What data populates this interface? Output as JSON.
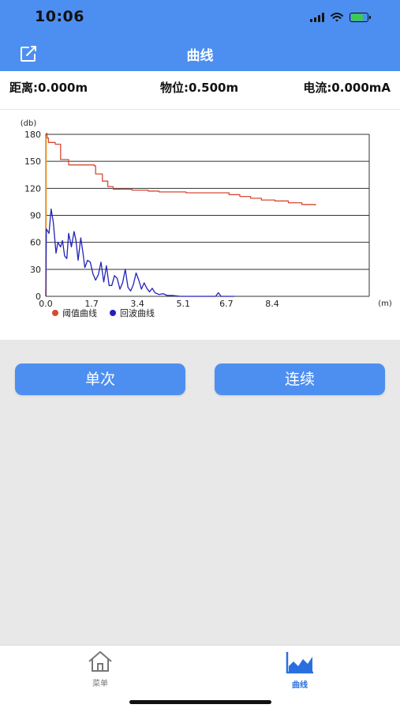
{
  "status_bar": {
    "time": "10:06",
    "battery_level": 0.8,
    "battery_color": "#3ccc4a"
  },
  "header": {
    "title": "曲线",
    "icon": "edit-icon",
    "background": "#4d8ff0"
  },
  "info": {
    "distance": "距离:0.000m",
    "level": "物位:0.500m",
    "current": "电流:0.000mA"
  },
  "chart_data": {
    "type": "line",
    "ylabel": "(db)",
    "xlabel": "(m)",
    "ylim": [
      0,
      180
    ],
    "xlim": [
      0,
      12
    ],
    "y_ticks": [
      "0",
      "30",
      "60",
      "90",
      "120",
      "150",
      "180"
    ],
    "x_ticks": [
      "0.0",
      "1.7",
      "3.4",
      "5.1",
      "6.7",
      "8.4"
    ],
    "x_tick_values": [
      0,
      1.7,
      3.4,
      5.1,
      6.7,
      8.4
    ],
    "grid": true,
    "legend_position": "bottom-left",
    "series": [
      {
        "name": "阈值曲线",
        "color": "#d84a36",
        "x": [
          0,
          0.05,
          0.1,
          0.3,
          0.35,
          0.5,
          0.55,
          0.8,
          0.85,
          1.5,
          1.8,
          1.85,
          2.1,
          2.3,
          2.5,
          2.8,
          3.2,
          3.8,
          4.2,
          4.8,
          5.2,
          6.0,
          6.8,
          7.2,
          7.6,
          8.0,
          8.5,
          9.0,
          9.5,
          10.0
        ],
        "values": [
          181,
          176,
          171,
          171,
          169,
          169,
          152,
          152,
          146,
          146,
          145,
          136,
          128,
          122,
          119,
          119,
          118,
          117,
          116,
          116,
          115,
          115,
          113,
          111,
          109,
          107,
          106,
          104,
          102,
          101
        ]
      },
      {
        "name": "回波曲线",
        "color": "#2222bb",
        "x": [
          0,
          0.02,
          0.12,
          0.2,
          0.28,
          0.38,
          0.45,
          0.55,
          0.62,
          0.7,
          0.78,
          0.85,
          0.95,
          1.05,
          1.12,
          1.2,
          1.3,
          1.38,
          1.45,
          1.55,
          1.65,
          1.75,
          1.85,
          1.95,
          2.05,
          2.15,
          2.25,
          2.35,
          2.45,
          2.55,
          2.65,
          2.75,
          2.85,
          2.95,
          3.05,
          3.15,
          3.25,
          3.35,
          3.45,
          3.55,
          3.65,
          3.75,
          3.85,
          3.95,
          4.05,
          4.2,
          4.35,
          4.5,
          4.7,
          5.0,
          5.5,
          6.0,
          6.3,
          6.4,
          6.5,
          6.7,
          7.0
        ],
        "values": [
          0,
          75,
          70,
          97,
          82,
          48,
          60,
          55,
          62,
          45,
          42,
          70,
          55,
          72,
          62,
          40,
          65,
          48,
          32,
          40,
          38,
          25,
          18,
          24,
          38,
          16,
          34,
          12,
          12,
          23,
          20,
          8,
          15,
          30,
          10,
          6,
          13,
          26,
          18,
          8,
          15,
          9,
          5,
          9,
          4,
          2,
          3,
          1,
          1,
          0,
          0,
          0,
          0,
          4,
          0,
          0,
          0
        ]
      }
    ]
  },
  "buttons": {
    "single": "单次",
    "continuous": "连续"
  },
  "tabs": [
    {
      "label": "菜单",
      "icon": "home-icon",
      "active": false,
      "color": "#777777"
    },
    {
      "label": "曲线",
      "icon": "area-chart-icon",
      "active": true,
      "color": "#2a6fe0"
    }
  ]
}
